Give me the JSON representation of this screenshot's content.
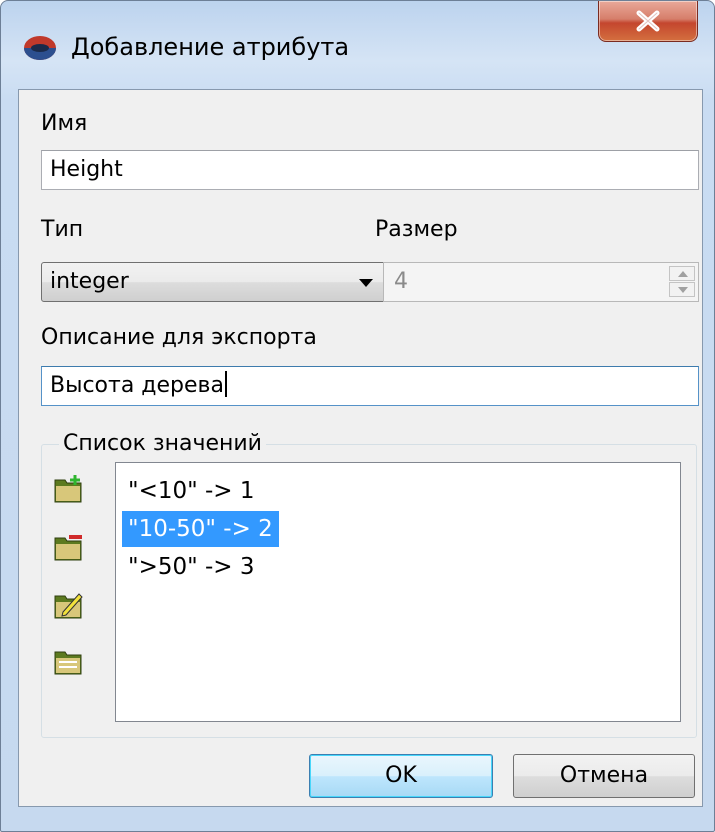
{
  "window": {
    "title": "Добавление атрибута",
    "close_label": "X"
  },
  "fields": {
    "name_label": "Имя",
    "name_value": "Height",
    "type_label": "Тип",
    "type_value": "integer",
    "size_label": "Размер",
    "size_value": "4",
    "export_label": "Описание для экспорта",
    "export_value": "Высота дерева"
  },
  "values_group": {
    "title": "Список значений",
    "tools": [
      "add-value-icon",
      "remove-value-icon",
      "edit-value-icon",
      "clear-values-icon"
    ],
    "items": [
      {
        "text": "\"<10\" -> 1",
        "selected": false
      },
      {
        "text": "\"10-50\" -> 2",
        "selected": true
      },
      {
        "text": "\">50\" -> 3",
        "selected": false
      }
    ]
  },
  "buttons": {
    "ok_label": "OK",
    "cancel_label": "Отмена"
  },
  "colors": {
    "selection": "#3399ff",
    "close_button": "#c4462e"
  }
}
